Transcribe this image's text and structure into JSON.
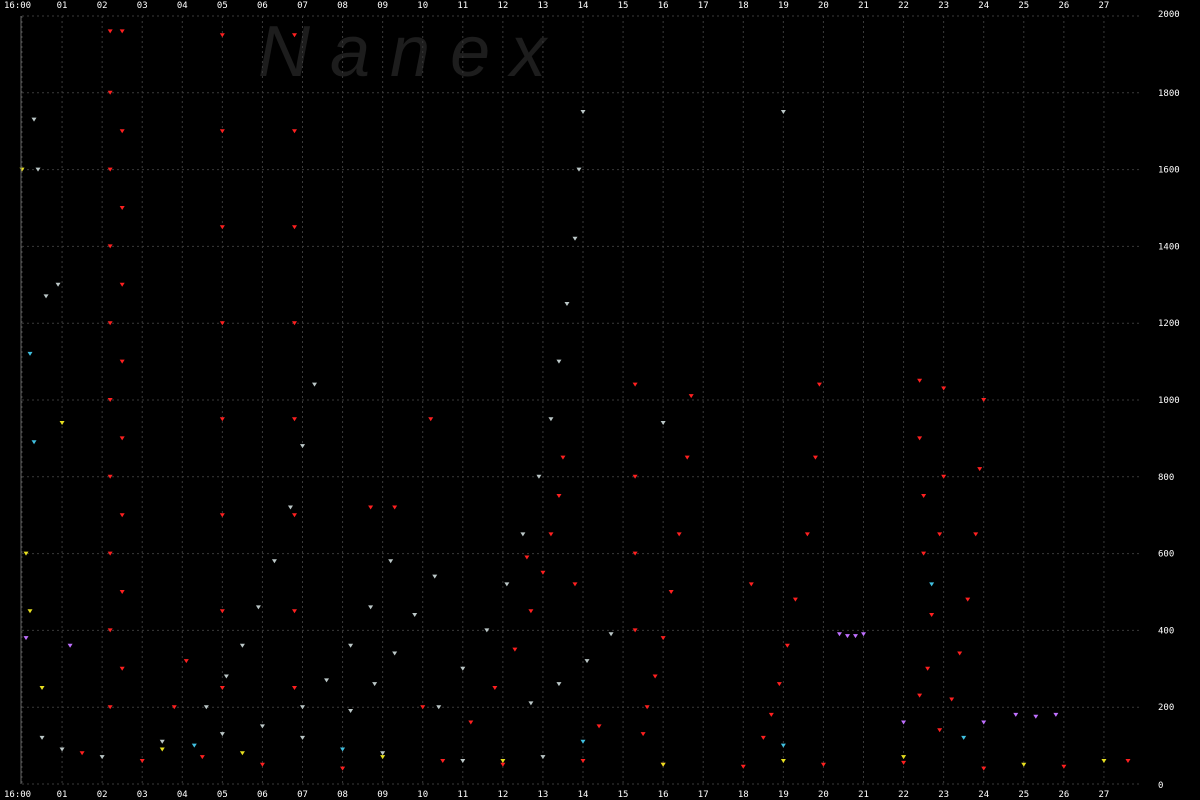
{
  "watermark": {
    "text": "N a n e x"
  },
  "chart_data": {
    "type": "scatter",
    "title": "",
    "xlabel": "",
    "ylabel": "",
    "x_ticks": [
      "16:00",
      "01",
      "02",
      "03",
      "04",
      "05",
      "06",
      "07",
      "08",
      "09",
      "10",
      "11",
      "12",
      "13",
      "14",
      "15",
      "16",
      "17",
      "18",
      "19",
      "20",
      "21",
      "22",
      "23",
      "24",
      "25",
      "26",
      "27"
    ],
    "xlim": [
      0,
      27.9
    ],
    "ylim": [
      0,
      2000
    ],
    "y_ticks": [
      "0",
      "200",
      "400",
      "600",
      "800",
      "1000",
      "1200",
      "1400",
      "1600",
      "1800",
      "2000"
    ],
    "grid": true,
    "colors": {
      "red": "#ff2020",
      "gray": "#bcc8c8",
      "yellow": "#e8e020",
      "violet": "#c070ff",
      "cyan": "#40c0e0",
      "grid": "#3a3a3a"
    },
    "series": [
      {
        "color": "red",
        "points": [
          [
            2.2,
            1960
          ],
          [
            2.2,
            1800
          ],
          [
            2.2,
            1600
          ],
          [
            2.2,
            1400
          ],
          [
            2.2,
            1200
          ],
          [
            2.2,
            1000
          ],
          [
            2.2,
            800
          ],
          [
            2.2,
            600
          ],
          [
            2.2,
            400
          ],
          [
            2.2,
            200
          ],
          [
            2.5,
            1960
          ],
          [
            2.5,
            1700
          ],
          [
            2.5,
            1500
          ],
          [
            2.5,
            1300
          ],
          [
            2.5,
            1100
          ],
          [
            2.5,
            900
          ],
          [
            2.5,
            700
          ],
          [
            2.5,
            500
          ],
          [
            2.5,
            300
          ],
          [
            5.0,
            1950
          ],
          [
            5.0,
            1700
          ],
          [
            5.0,
            1450
          ],
          [
            5.0,
            1200
          ],
          [
            5.0,
            950
          ],
          [
            5.0,
            700
          ],
          [
            5.0,
            450
          ],
          [
            5.0,
            250
          ],
          [
            6.8,
            1950
          ],
          [
            6.8,
            1700
          ],
          [
            6.8,
            1450
          ],
          [
            6.8,
            1200
          ],
          [
            6.8,
            950
          ],
          [
            6.8,
            700
          ],
          [
            6.8,
            450
          ],
          [
            6.8,
            250
          ],
          [
            13.5,
            850
          ],
          [
            13.4,
            750
          ],
          [
            13.2,
            650
          ],
          [
            13.0,
            550
          ],
          [
            12.7,
            450
          ],
          [
            12.3,
            350
          ],
          [
            11.8,
            250
          ],
          [
            11.2,
            160
          ],
          [
            15.3,
            1040
          ],
          [
            15.3,
            800
          ],
          [
            15.3,
            600
          ],
          [
            15.3,
            400
          ],
          [
            16.7,
            1010
          ],
          [
            16.6,
            850
          ],
          [
            16.4,
            650
          ],
          [
            16.2,
            500
          ],
          [
            16.0,
            380
          ],
          [
            15.8,
            280
          ],
          [
            15.6,
            200
          ],
          [
            15.5,
            130
          ],
          [
            19.9,
            1040
          ],
          [
            19.8,
            850
          ],
          [
            19.6,
            650
          ],
          [
            19.3,
            480
          ],
          [
            19.1,
            360
          ],
          [
            18.9,
            260
          ],
          [
            18.7,
            180
          ],
          [
            18.5,
            120
          ],
          [
            22.4,
            1050
          ],
          [
            22.4,
            900
          ],
          [
            22.5,
            750
          ],
          [
            22.5,
            600
          ],
          [
            22.7,
            440
          ],
          [
            22.6,
            300
          ],
          [
            22.4,
            230
          ],
          [
            23.0,
            1030
          ],
          [
            23.0,
            800
          ],
          [
            22.9,
            650
          ],
          [
            24.0,
            1000
          ],
          [
            23.9,
            820
          ],
          [
            23.8,
            650
          ],
          [
            23.6,
            480
          ],
          [
            23.4,
            340
          ],
          [
            23.2,
            220
          ],
          [
            22.9,
            140
          ],
          [
            3.8,
            200
          ],
          [
            4.1,
            320
          ],
          [
            10.2,
            950
          ],
          [
            18.2,
            520
          ],
          [
            8.7,
            720
          ],
          [
            9.3,
            720
          ],
          [
            10.0,
            200
          ],
          [
            12.6,
            590
          ],
          [
            13.8,
            520
          ],
          [
            14.4,
            150
          ],
          [
            1.5,
            80
          ],
          [
            3.0,
            60
          ],
          [
            4.5,
            70
          ],
          [
            6.0,
            50
          ],
          [
            8.0,
            40
          ],
          [
            10.5,
            60
          ],
          [
            12.0,
            50
          ],
          [
            14.0,
            60
          ],
          [
            16.0,
            50
          ],
          [
            18.0,
            45
          ],
          [
            20.0,
            50
          ],
          [
            22.0,
            55
          ],
          [
            24.0,
            40
          ],
          [
            26.0,
            45
          ],
          [
            27.6,
            60
          ]
        ]
      },
      {
        "color": "gray",
        "points": [
          [
            14.0,
            1750
          ],
          [
            13.9,
            1600
          ],
          [
            13.8,
            1420
          ],
          [
            13.6,
            1250
          ],
          [
            13.4,
            1100
          ],
          [
            13.2,
            950
          ],
          [
            12.9,
            800
          ],
          [
            12.5,
            650
          ],
          [
            12.1,
            520
          ],
          [
            11.6,
            400
          ],
          [
            11.0,
            300
          ],
          [
            10.4,
            200
          ],
          [
            7.3,
            1040
          ],
          [
            7.0,
            880
          ],
          [
            6.7,
            720
          ],
          [
            6.3,
            580
          ],
          [
            5.9,
            460
          ],
          [
            5.5,
            360
          ],
          [
            5.1,
            280
          ],
          [
            4.6,
            200
          ],
          [
            9.2,
            580
          ],
          [
            8.7,
            460
          ],
          [
            8.2,
            360
          ],
          [
            7.6,
            270
          ],
          [
            7.0,
            200
          ],
          [
            10.3,
            540
          ],
          [
            9.8,
            440
          ],
          [
            9.3,
            340
          ],
          [
            8.8,
            260
          ],
          [
            8.2,
            190
          ],
          [
            14.7,
            390
          ],
          [
            14.1,
            320
          ],
          [
            13.4,
            260
          ],
          [
            12.7,
            210
          ],
          [
            0.3,
            1730
          ],
          [
            0.4,
            1600
          ],
          [
            0.6,
            1270
          ],
          [
            0.9,
            1300
          ],
          [
            19.0,
            1750
          ],
          [
            16.0,
            940
          ],
          [
            0.5,
            120
          ],
          [
            1.0,
            90
          ],
          [
            2.0,
            70
          ],
          [
            3.5,
            110
          ],
          [
            5.0,
            130
          ],
          [
            6.0,
            150
          ],
          [
            7.0,
            120
          ],
          [
            9.0,
            80
          ],
          [
            11.0,
            60
          ],
          [
            13.0,
            70
          ]
        ]
      },
      {
        "color": "yellow",
        "points": [
          [
            0.0,
            1600
          ],
          [
            0.1,
            600
          ],
          [
            0.2,
            450
          ],
          [
            1.0,
            940
          ],
          [
            0.5,
            250
          ],
          [
            3.5,
            90
          ],
          [
            5.5,
            80
          ],
          [
            9.0,
            70
          ],
          [
            12.0,
            60
          ],
          [
            16.0,
            50
          ],
          [
            19.0,
            60
          ],
          [
            22.0,
            70
          ],
          [
            25.0,
            50
          ],
          [
            27.0,
            60
          ]
        ]
      },
      {
        "color": "violet",
        "points": [
          [
            20.4,
            390
          ],
          [
            20.6,
            385
          ],
          [
            20.8,
            385
          ],
          [
            21.0,
            390
          ],
          [
            24.8,
            180
          ],
          [
            25.3,
            175
          ],
          [
            25.8,
            180
          ],
          [
            22.0,
            160
          ],
          [
            24.0,
            160
          ],
          [
            0.1,
            380
          ],
          [
            1.2,
            360
          ]
        ]
      },
      {
        "color": "cyan",
        "points": [
          [
            0.2,
            1120
          ],
          [
            0.3,
            890
          ],
          [
            22.7,
            520
          ],
          [
            4.3,
            100
          ],
          [
            8.0,
            90
          ],
          [
            14.0,
            110
          ],
          [
            19.0,
            100
          ],
          [
            23.5,
            120
          ]
        ]
      }
    ]
  }
}
